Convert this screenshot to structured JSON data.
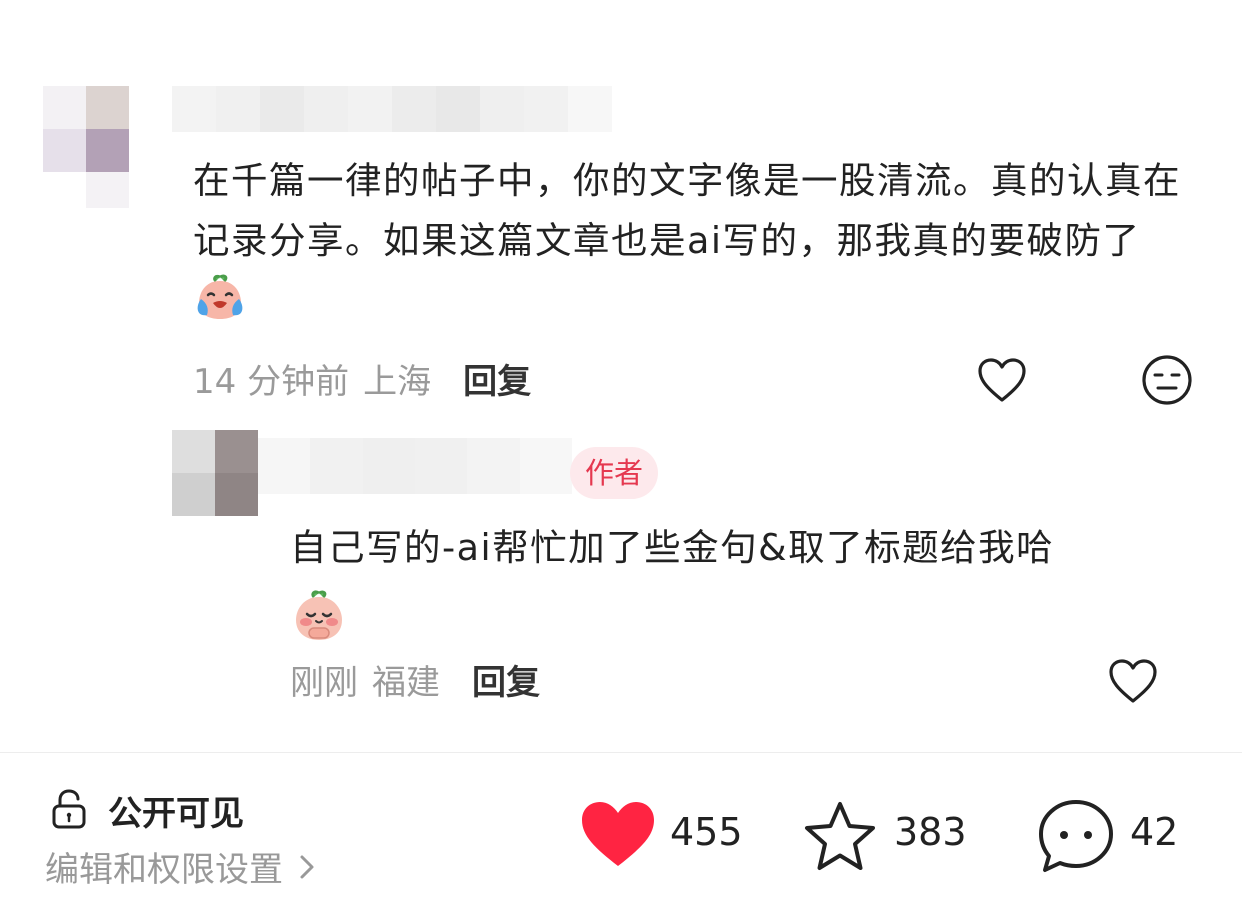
{
  "comments": [
    {
      "text": "在千篇一律的帖子中，你的文字像是一股清流。真的认真在记录分享。如果这篇文章也是ai写的，那我真的要破防了",
      "emoji": "crying-peach-emoji",
      "time": "14 分钟前",
      "region": "上海",
      "reply_label": "回复",
      "actions": [
        "heart-outline-icon",
        "meh-face-icon"
      ]
    },
    {
      "badge": "作者",
      "text": "自己写的-ai帮忙加了些金句&取了标题给我哈",
      "emoji": "pleading-peach-emoji",
      "time": "刚刚",
      "region": "福建",
      "reply_label": "回复",
      "actions": [
        "heart-outline-icon"
      ]
    }
  ],
  "bottom_bar": {
    "visibility_label": "公开可见",
    "settings_label": "编辑和权限设置",
    "likes": "455",
    "stars": "383",
    "comments": "42"
  },
  "colors": {
    "accent_red": "#ff2442",
    "badge_bg": "#fde9ec",
    "badge_text": "#e5384f",
    "muted_text": "#9a9a9a"
  }
}
